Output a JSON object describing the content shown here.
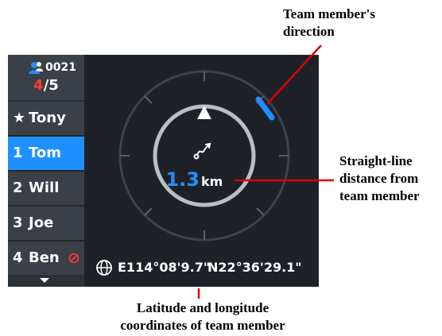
{
  "sidebar": {
    "team_id": "0021",
    "count_online": "4",
    "count_total": "/5",
    "members": [
      {
        "index": "★",
        "name": "Tony",
        "active": false,
        "muted": false
      },
      {
        "index": "1",
        "name": "Tom",
        "active": true,
        "muted": false
      },
      {
        "index": "2",
        "name": "Will",
        "active": false,
        "muted": false
      },
      {
        "index": "3",
        "name": "Joe",
        "active": false,
        "muted": false
      },
      {
        "index": "4",
        "name": "Ben",
        "active": false,
        "muted": true
      }
    ]
  },
  "compass": {
    "distance_value": "1.3",
    "distance_unit": "km"
  },
  "coords": {
    "longitude": "E114°08'9.7\"",
    "latitude": "N22°36'29.1\""
  },
  "annotations": {
    "direction": "Team member's direction",
    "distance": "Straight-line distance from team member",
    "coordinates": "Latitude and longitude coordinates of team member"
  },
  "colors": {
    "accent": "#1e90ff",
    "alert": "#ff3b30",
    "annotation_line": "#e00000"
  }
}
